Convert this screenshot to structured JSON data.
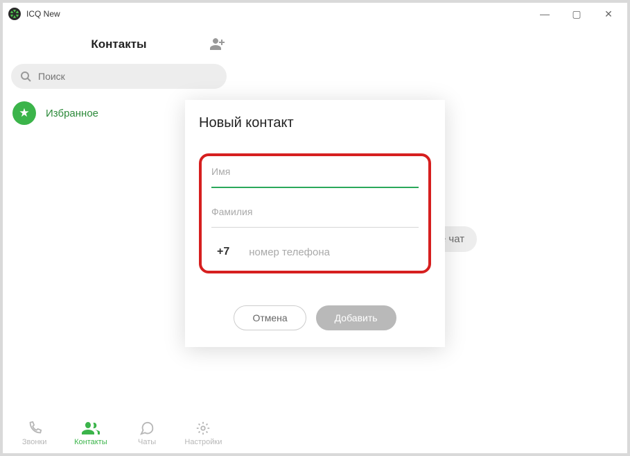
{
  "app": {
    "title": "ICQ New"
  },
  "window": {
    "minimize": "—",
    "maximize": "▢",
    "close": "✕"
  },
  "sidebar": {
    "title": "Контакты",
    "add_icon": "add-contact",
    "search_placeholder": "Поиск",
    "favorites_label": "Избранное"
  },
  "nav": [
    {
      "id": "calls",
      "label": "Звонки"
    },
    {
      "id": "contacts",
      "label": "Контакты"
    },
    {
      "id": "chats",
      "label": "Чаты"
    },
    {
      "id": "settings",
      "label": "Настройки"
    }
  ],
  "content": {
    "select_chat": "Выберите чат"
  },
  "modal": {
    "title": "Новый контакт",
    "name_label": "Имя",
    "surname_label": "Фамилия",
    "country_code": "+7",
    "phone_placeholder": "номер телефона",
    "cancel": "Отмена",
    "submit": "Добавить"
  }
}
